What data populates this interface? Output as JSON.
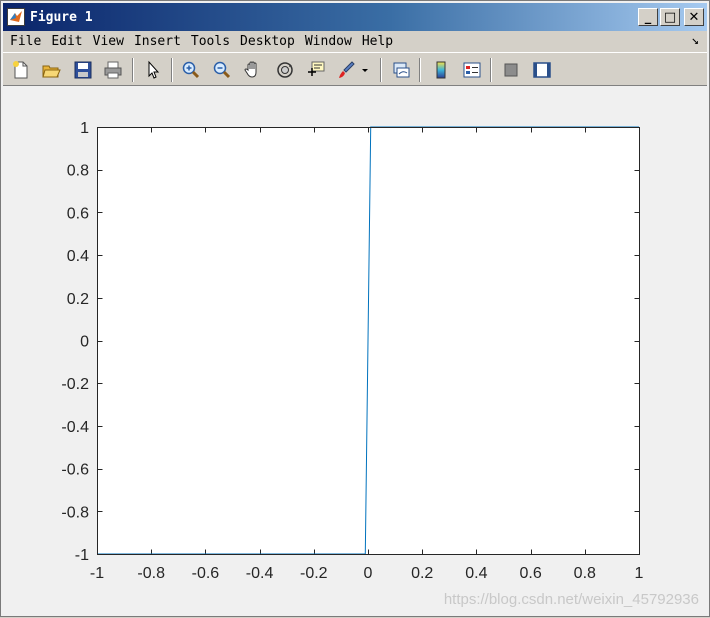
{
  "window": {
    "title": "Figure 1",
    "minimize_glyph": "_",
    "maximize_glyph": "□",
    "close_glyph": "✕"
  },
  "menubar": {
    "items": [
      "File",
      "Edit",
      "View",
      "Insert",
      "Tools",
      "Desktop",
      "Window",
      "Help"
    ],
    "dock_glyph": "↘"
  },
  "toolbar": {
    "icons": [
      "new-figure-icon",
      "open-file-icon",
      "save-icon",
      "print-icon",
      "edit-plot-arrow-icon",
      "zoom-in-icon",
      "zoom-out-icon",
      "pan-hand-icon",
      "rotate-3d-icon",
      "data-cursor-icon",
      "brush-icon",
      "brush-dropdown-icon",
      "link-plot-icon",
      "insert-colorbar-icon",
      "insert-legend-icon",
      "hide-plot-tools-icon",
      "show-plot-tools-icon"
    ]
  },
  "colors": {
    "line": "#0072bd",
    "axes_bg": "#ffffff",
    "figure_bg": "#f0f0f0"
  },
  "watermark": "https://blog.csdn.net/weixin_45792936",
  "chart_data": {
    "type": "line",
    "title": "",
    "xlabel": "",
    "ylabel": "",
    "xlim": [
      -1,
      1
    ],
    "ylim": [
      -1,
      1
    ],
    "xticks": [
      -1,
      -0.8,
      -0.6,
      -0.4,
      -0.2,
      0,
      0.2,
      0.4,
      0.6,
      0.8,
      1
    ],
    "yticks": [
      -1,
      -0.8,
      -0.6,
      -0.4,
      -0.2,
      0,
      0.2,
      0.4,
      0.6,
      0.8,
      1
    ],
    "xtick_labels": [
      "-1",
      "-0.8",
      "-0.6",
      "-0.4",
      "-0.2",
      "0",
      "0.2",
      "0.4",
      "0.6",
      "0.8",
      "1"
    ],
    "ytick_labels": [
      "-1",
      "-0.8",
      "-0.6",
      "-0.4",
      "-0.2",
      "0",
      "0.2",
      "0.4",
      "0.6",
      "0.8",
      "1"
    ],
    "grid": false,
    "series": [
      {
        "x": [
          -1,
          -0.01,
          0.01,
          1
        ],
        "y": [
          -1,
          -1,
          1,
          1
        ]
      }
    ]
  }
}
